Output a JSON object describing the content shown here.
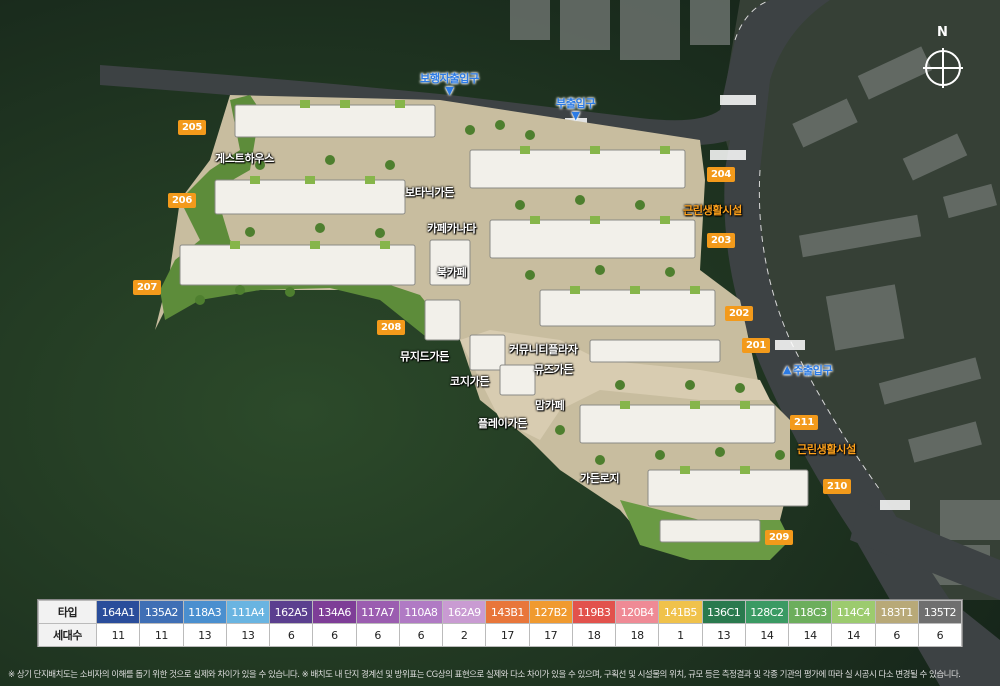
{
  "colors": {
    "forest": "#1f3320",
    "road": "#3d4244",
    "plaza": "#d8ccb1",
    "badge": "#f39a1b",
    "entrance_blue": "#2c7be5"
  },
  "compass": {
    "letter": "N"
  },
  "entrances": {
    "pedestrian": "보행자출입구",
    "sub": "부출입구",
    "main": "주출입구"
  },
  "buildings": [
    "205",
    "206",
    "207",
    "208",
    "204",
    "203",
    "202",
    "201",
    "211",
    "210",
    "209"
  ],
  "places": {
    "guesthouse": "게스트하우스",
    "botanic": "보타닉가든",
    "cafe_canada": "카페카나다",
    "book_cafe": "북카페",
    "music_garden": "뮤지드가든",
    "community_plaza": "커뮤니티플라자",
    "muse_garden": "뮤즈가든",
    "kids_garden": "코지가든",
    "mom_cafe": "맘카페",
    "play_garden": "플레이가든",
    "garden_road": "가든로지",
    "amenity_1": "근린생활시설",
    "amenity_2": "근린생활시설"
  },
  "legend": {
    "type_header": "타입",
    "count_header": "세대수",
    "types": [
      {
        "name": "164A1",
        "count": "11",
        "color": "#2a4d9b"
      },
      {
        "name": "135A2",
        "count": "11",
        "color": "#3f6fb5"
      },
      {
        "name": "118A3",
        "count": "13",
        "color": "#4a8fcf"
      },
      {
        "name": "111A4",
        "count": "13",
        "color": "#69b4e1"
      },
      {
        "name": "162A5",
        "count": "6",
        "color": "#5b3f8f"
      },
      {
        "name": "134A6",
        "count": "6",
        "color": "#7e3d97"
      },
      {
        "name": "117A7",
        "count": "6",
        "color": "#9b5db0"
      },
      {
        "name": "110A8",
        "count": "6",
        "color": "#b07ac4"
      },
      {
        "name": "162A9",
        "count": "2",
        "color": "#c99bd2"
      },
      {
        "name": "143B1",
        "count": "17",
        "color": "#e8763a"
      },
      {
        "name": "127B2",
        "count": "17",
        "color": "#f09a2f"
      },
      {
        "name": "119B3",
        "count": "18",
        "color": "#e2524c"
      },
      {
        "name": "120B4",
        "count": "18",
        "color": "#ef8a95"
      },
      {
        "name": "141B5",
        "count": "1",
        "color": "#f0c24b"
      },
      {
        "name": "136C1",
        "count": "13",
        "color": "#2a7a4e"
      },
      {
        "name": "128C2",
        "count": "14",
        "color": "#3a9a63"
      },
      {
        "name": "118C3",
        "count": "14",
        "color": "#6cae5c"
      },
      {
        "name": "114C4",
        "count": "14",
        "color": "#9ccb6e"
      },
      {
        "name": "183T1",
        "count": "6",
        "color": "#b8a978"
      },
      {
        "name": "135T2",
        "count": "6",
        "color": "#6f6f6f"
      }
    ]
  },
  "note": "※ 상기 단지배치도는 소비자의 이해를 돕기 위한 것으로 실제와 차이가 있을 수 있습니다. ※ 배치도 내 단지 경계선 및 방위표는 CG상의 표현으로 실제와 다소 차이가 있을 수 있으며, 구획선 및 시설물의 위치, 규모 등은 측정결과 및 각종 기관의 평가에 따라 실 시공시 다소 변경될 수 있습니다."
}
